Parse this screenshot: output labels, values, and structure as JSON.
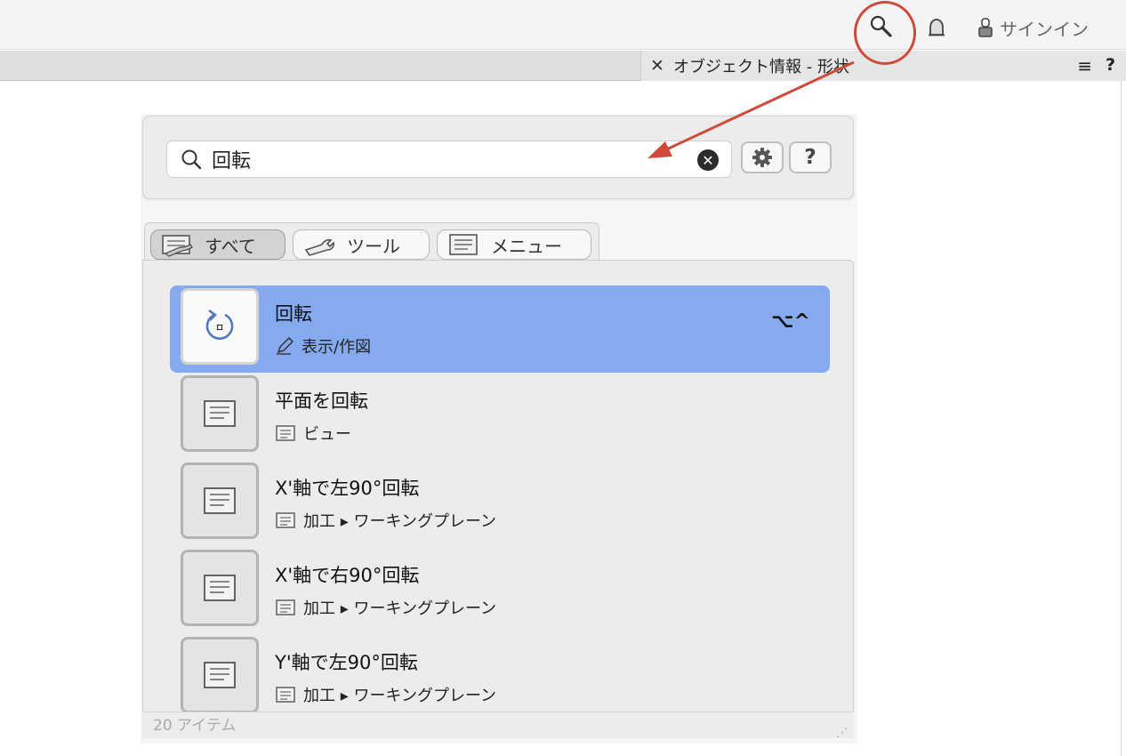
{
  "topbar": {
    "signin_label": "サインイン"
  },
  "palette": {
    "close_label": "✕",
    "title": "オブジェクト情報 - 形状",
    "menu_label": "≡",
    "help_label": "?"
  },
  "search": {
    "value": "回転",
    "clear_label": "✕",
    "help_label": "?"
  },
  "tabs": [
    {
      "label": "すべて",
      "active": true
    },
    {
      "label": "ツール",
      "active": false
    },
    {
      "label": "メニュー",
      "active": false
    }
  ],
  "results": [
    {
      "title": "回転",
      "path": "表示/作図",
      "path_icon": "pencil-icon",
      "thumb_icon": "rotate-icon",
      "shortcut": "⌥^",
      "selected": true
    },
    {
      "title": "平面を回転",
      "path": "ビュー",
      "path_icon": "menu-icon",
      "thumb_icon": "menu-icon",
      "shortcut": "",
      "selected": false
    },
    {
      "title": "X'軸で左90°回転",
      "path": "加工 ▸ ワーキングプレーン",
      "path_icon": "menu-icon",
      "thumb_icon": "menu-icon",
      "shortcut": "",
      "selected": false
    },
    {
      "title": "X'軸で右90°回転",
      "path": "加工 ▸ ワーキングプレーン",
      "path_icon": "menu-icon",
      "thumb_icon": "menu-icon",
      "shortcut": "",
      "selected": false
    },
    {
      "title": "Y'軸で左90°回転",
      "path": "加工 ▸ ワーキングプレーン",
      "path_icon": "menu-icon",
      "thumb_icon": "menu-icon",
      "shortcut": "",
      "selected": false
    }
  ],
  "footer": {
    "count_label": "20 アイテム"
  },
  "colors": {
    "selection": "#85aaf0",
    "annotation": "#d04a3c"
  }
}
